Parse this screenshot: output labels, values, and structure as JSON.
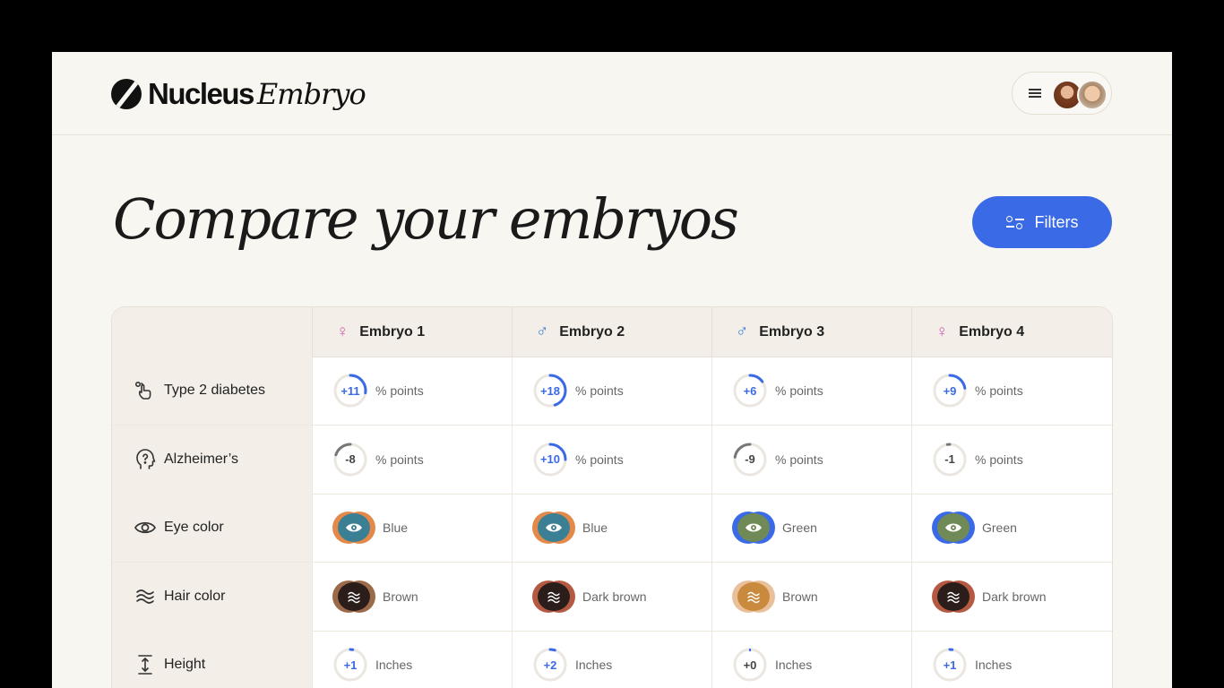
{
  "brand": {
    "name": "Nucleus",
    "product": "Embryo"
  },
  "header": {
    "menu_icon": "hamburger-icon",
    "avatars": [
      "female-avatar",
      "male-avatar"
    ]
  },
  "page": {
    "title": "Compare your embryos",
    "filters_label": "Filters",
    "accent": "#3a6ae6"
  },
  "columns": [
    {
      "label": "Embryo 1",
      "sex": "♀",
      "sex_type": "female"
    },
    {
      "label": "Embryo 2",
      "sex": "♂",
      "sex_type": "male"
    },
    {
      "label": "Embryo 3",
      "sex": "♂",
      "sex_type": "male"
    },
    {
      "label": "Embryo 4",
      "sex": "♀",
      "sex_type": "female"
    }
  ],
  "rows": [
    {
      "label": "Type 2 diabetes",
      "icon": "hand-tap-icon",
      "kind": "gauge",
      "cells": [
        {
          "value": "+11",
          "unit": "% points"
        },
        {
          "value": "+18",
          "unit": "% points"
        },
        {
          "value": "+6",
          "unit": "% points"
        },
        {
          "value": "+9",
          "unit": "% points"
        }
      ]
    },
    {
      "label": "Alzheimer’s",
      "icon": "head-question-icon",
      "kind": "gauge",
      "cells": [
        {
          "value": "-8",
          "unit": "% points"
        },
        {
          "value": "+10",
          "unit": "% points"
        },
        {
          "value": "-9",
          "unit": "% points"
        },
        {
          "value": "-1",
          "unit": "% points"
        }
      ]
    },
    {
      "label": "Eye color",
      "icon": "eye-icon",
      "kind": "swatch",
      "cells": [
        {
          "value": "Blue",
          "color": "#3b7f95",
          "ring": "#e3894a"
        },
        {
          "value": "Blue",
          "color": "#3b7f95",
          "ring": "#e3894a"
        },
        {
          "value": "Green",
          "color": "#6f8a57",
          "ring": "#3a6ae6"
        },
        {
          "value": "Green",
          "color": "#6f8a57",
          "ring": "#3a6ae6"
        }
      ]
    },
    {
      "label": "Hair color",
      "icon": "waves-icon",
      "kind": "swatch",
      "cells": [
        {
          "value": "Brown",
          "color": "#2b1d1a",
          "ring": "#9b6a4a"
        },
        {
          "value": "Dark brown",
          "color": "#2b1d1a",
          "ring": "#b45a43"
        },
        {
          "value": "Brown",
          "color": "#c98a3e",
          "ring": "#eac09a"
        },
        {
          "value": "Dark brown",
          "color": "#2b1d1a",
          "ring": "#b45a43"
        }
      ]
    },
    {
      "label": "Height",
      "icon": "height-arrows-icon",
      "kind": "gauge",
      "cells": [
        {
          "value": "+1",
          "unit": "Inches"
        },
        {
          "value": "+2",
          "unit": "Inches"
        },
        {
          "value": "+0",
          "unit": "Inches"
        },
        {
          "value": "+1",
          "unit": "Inches"
        }
      ]
    }
  ]
}
